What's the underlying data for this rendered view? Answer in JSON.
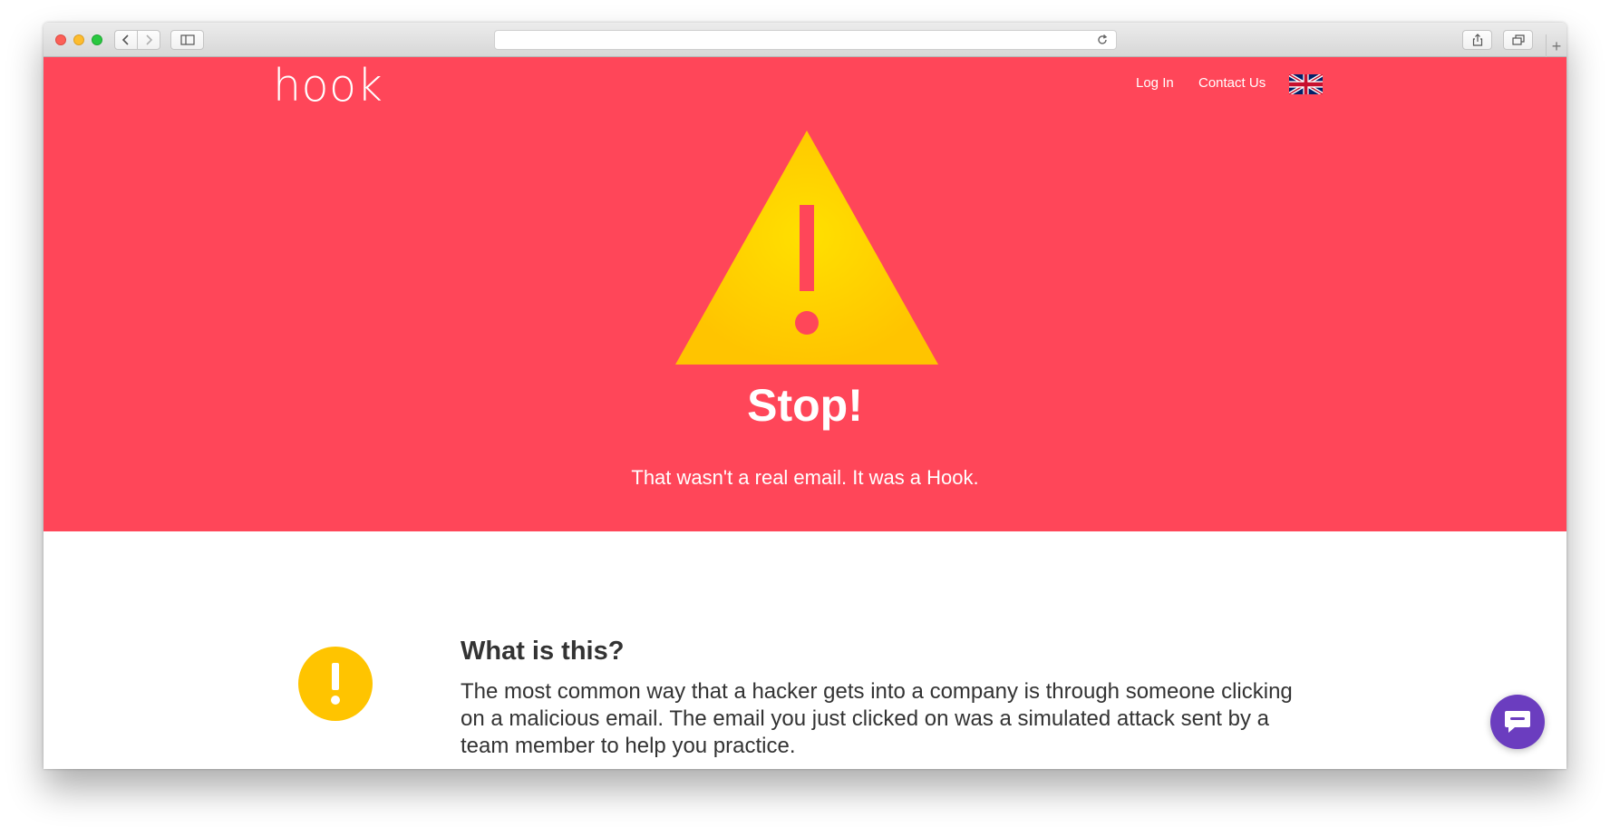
{
  "browser": {
    "url": "",
    "icons": {
      "back": "chevron-left-icon",
      "forward": "chevron-right-icon",
      "sidebar": "sidebar-icon",
      "reload": "reload-icon",
      "share": "share-icon",
      "tabs": "tabs-overview-icon",
      "new_tab": "plus-icon"
    },
    "new_tab_symbol": "+"
  },
  "header": {
    "logo": "hook",
    "nav": {
      "login": "Log In",
      "contact": "Contact Us"
    },
    "language_flag": "uk-flag-icon"
  },
  "hero": {
    "icon": "warning-triangle-icon",
    "title": "Stop!",
    "subtitle": "That wasn't a real email. It was a Hook."
  },
  "info": {
    "icon": "exclamation-icon",
    "icon_symbol": "!",
    "heading": "What is this?",
    "body": "The most common way that a hacker gets into a company is through someone clicking on a malicious email. The email you just clicked on was a simulated attack sent by a team member to help you practice."
  },
  "chat": {
    "icon": "chat-bubble-icon"
  },
  "colors": {
    "hero_background": "#ff4659",
    "warning_yellow": "#ffc400",
    "chat_purple": "#6b3dbf",
    "text_dark": "#333333"
  }
}
